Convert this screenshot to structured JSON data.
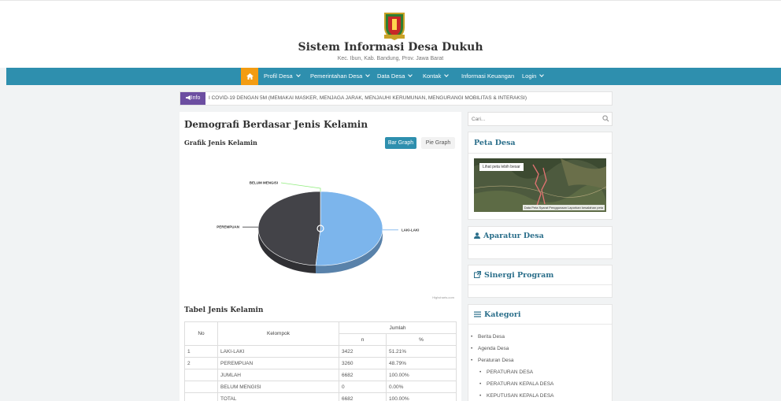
{
  "site": {
    "title": "Sistem Informasi Desa Dukuh",
    "subtitle": "Kec. Ibun, Kab. Bandung, Prov. Jawa Barat"
  },
  "nav": {
    "items": [
      {
        "label": "Profil Desa",
        "dropdown": true
      },
      {
        "label": "Pemerintahan Desa",
        "dropdown": true
      },
      {
        "label": "Data Desa",
        "dropdown": true
      },
      {
        "label": "Kontak",
        "dropdown": true
      },
      {
        "label": "Informasi Keuangan",
        "dropdown": false
      },
      {
        "label": "Login",
        "dropdown": true
      }
    ]
  },
  "info": {
    "badge": "Info",
    "text": "I COVID-19 DENGAN 5M (MEMAKAI MASKER, MENJAGA JARAK, MENJAUHI KERUMUNAN, MENGURANGI MOBILITAS & INTERAKSI)"
  },
  "main": {
    "title": "Demografi Berdasar Jenis Kelamin",
    "graph_label": "Grafik Jenis Kelamin",
    "bar_button": "Bar Graph",
    "pie_button": "Pie Graph",
    "credit": "Highcharts.com",
    "table_title": "Tabel Jenis Kelamin"
  },
  "table": {
    "headers": {
      "no": "No",
      "kelompok": "Kelompok",
      "jumlah": "Jumlah",
      "n": "n",
      "pct": "%"
    },
    "rows": [
      {
        "no": "1",
        "kelompok": "LAKI-LAKI",
        "n": "3422",
        "pct": "51.21%"
      },
      {
        "no": "2",
        "kelompok": "PEREMPUAN",
        "n": "3260",
        "pct": "48.79%"
      },
      {
        "no": "",
        "kelompok": "JUMLAH",
        "n": "6682",
        "pct": "100.00%"
      },
      {
        "no": "",
        "kelompok": "BELUM MENGISI",
        "n": "0",
        "pct": "0.00%"
      },
      {
        "no": "",
        "kelompok": "TOTAL",
        "n": "6682",
        "pct": "100.00%"
      }
    ]
  },
  "chart_data": {
    "type": "pie",
    "categories": [
      "LAKI-LAKI",
      "PEREMPUAN",
      "BELUM MENGISI"
    ],
    "values": [
      3422,
      3260,
      0
    ],
    "colors": [
      "#7cb5ec",
      "#434348",
      "#90ed7d"
    ]
  },
  "sidebar": {
    "search_placeholder": "Cari...",
    "peta_title": "Peta Desa",
    "map_link": "Lihat peta lebih besar",
    "map_attribution": "Data Peta  Syarat Penggunaan  Laporkan kesalahan peta",
    "aparatur_title": "Aparatur Desa",
    "sinergi_title": "Sinergi Program",
    "kategori_title": "Kategori",
    "kategori": [
      {
        "label": "Berita Desa",
        "sub": false
      },
      {
        "label": "Agenda Desa",
        "sub": false
      },
      {
        "label": "Peraturan Desa",
        "sub": false
      },
      {
        "label": "PERATURAN DESA",
        "sub": true
      },
      {
        "label": "PERATURAN KEPALA DESA",
        "sub": true
      },
      {
        "label": "KEPUTUSAN KEPALA DESA",
        "sub": true
      }
    ]
  },
  "colors": {
    "nav_bg": "#2e8fae",
    "home_bg": "#f39c12",
    "info_badge": "#6c4ea1",
    "heading_blue": "#2a6e8a"
  }
}
